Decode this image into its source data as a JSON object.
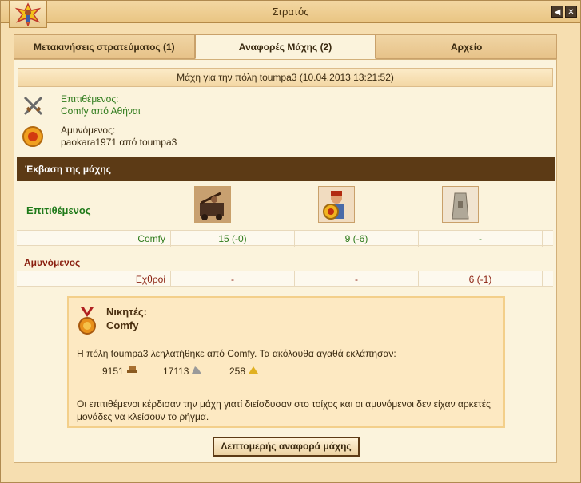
{
  "window": {
    "title": "Στρατός"
  },
  "tabs": [
    {
      "label": "Μετακινήσεις στρατεύματος (1)"
    },
    {
      "label": "Αναφορές Μάχης (2)"
    },
    {
      "label": "Αρχείο"
    }
  ],
  "report": {
    "title": "Μάχη για την πόλη toumpa3 (10.04.2013 13:21:52)",
    "attacker_label": "Επιτιθέμενος:",
    "attacker_value": "Comfy από Αθήναι",
    "defender_label": "Αμυνόμενος:",
    "defender_value": "paokara1971 από toumpa3"
  },
  "outcome": {
    "header": "Έκβαση της μάχης",
    "attacker_side": "Επιτιθέμενος",
    "defender_side": "Αμυνόμενος",
    "units": [
      {
        "icon": "siege-unit-icon"
      },
      {
        "icon": "hoplite-unit-icon"
      },
      {
        "icon": "wall-icon"
      }
    ],
    "attacker_row": {
      "name": "Comfy",
      "values": [
        "15 (-0)",
        "9 (-6)",
        "-"
      ]
    },
    "defender_row": {
      "name": "Εχθροί",
      "values": [
        "-",
        "-",
        "6 (-1)"
      ]
    }
  },
  "result": {
    "winners_label": "Νικητές:",
    "winner": "Comfy",
    "plunder_text": "Η πόλη toumpa3 λεηλατήθηκε από Comfy. Τα ακόλουθα αγαθά εκλάπησαν:",
    "resources": [
      {
        "amount": "9151",
        "icon": "wood-icon"
      },
      {
        "amount": "17113",
        "icon": "marble-icon"
      },
      {
        "amount": "258",
        "icon": "sulfur-icon"
      }
    ],
    "explanation": "Οι επιτιθέμενοι κέρδισαν την μάχη γιατί διείσδυσαν στο τοίχος και οι αμυνόμενοι δεν είχαν αρκετές μονάδες να κλείσουν το ρήγμα."
  },
  "buttons": {
    "detail": "Λεπτομερής αναφορά μάχης"
  }
}
